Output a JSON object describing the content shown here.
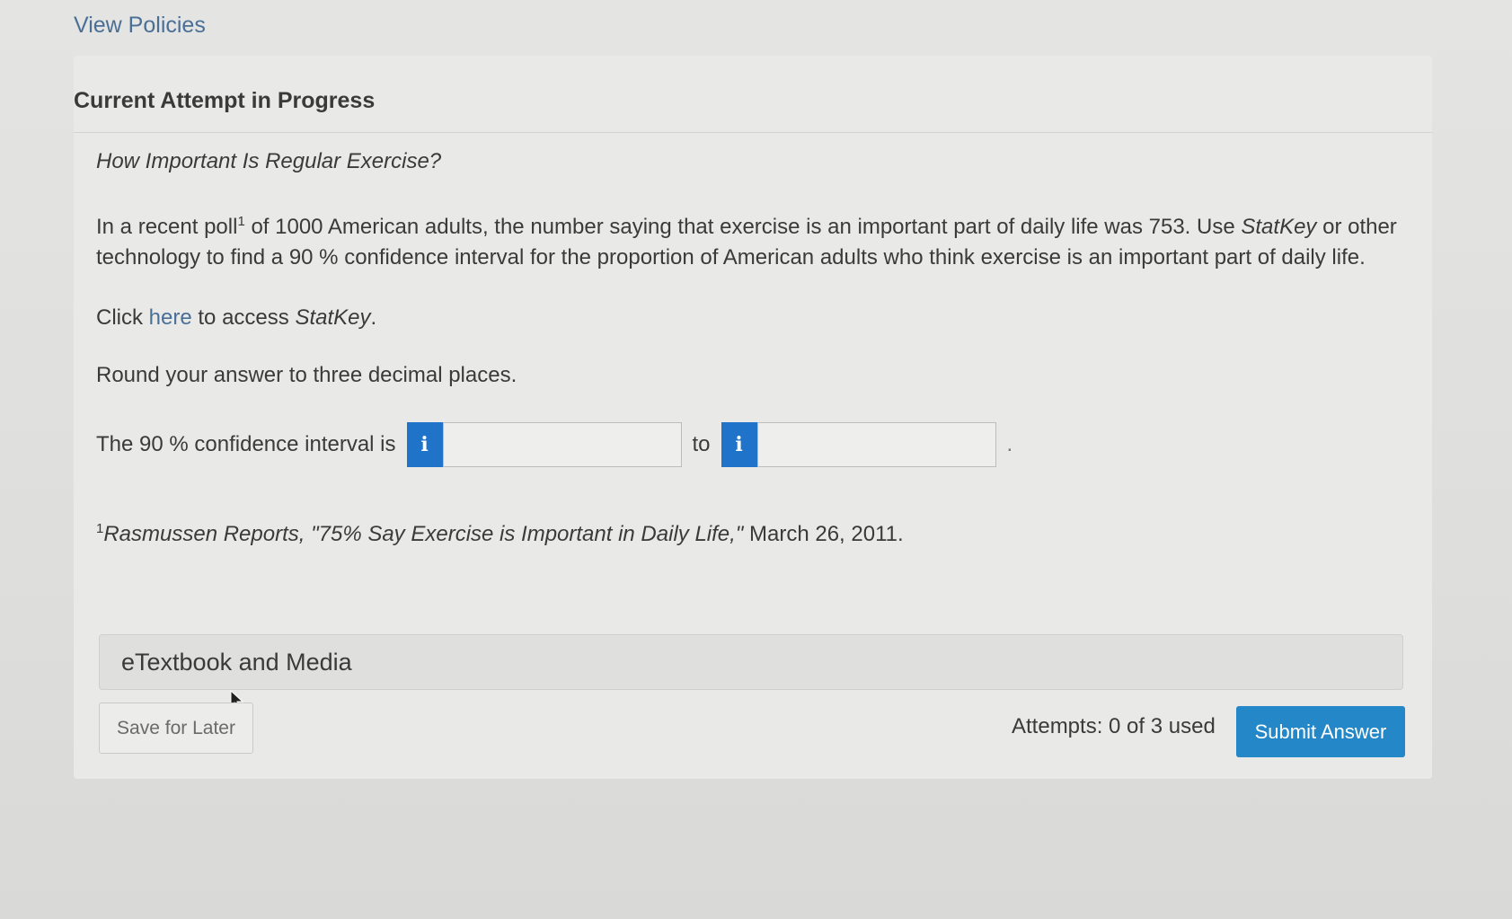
{
  "header": {
    "view_policies": "View Policies"
  },
  "attempt": {
    "title": "Current Attempt in Progress"
  },
  "question": {
    "title": "How Important Is Regular Exercise?",
    "body_part1": "In a recent poll",
    "body_sup": "1",
    "body_part2": " of 1000 American adults, the number saying that exercise is an important part of daily life was 753. Use ",
    "body_statkey": "StatKey",
    "body_part3": " or other technology to find a 90 % confidence interval for the proportion of American adults who think exercise is an important part of daily life.",
    "statkey_prefix": "Click ",
    "statkey_link": "here",
    "statkey_mid": " to access ",
    "statkey_name": "StatKey",
    "statkey_suffix": ".",
    "round_instruction": "Round your answer to three decimal places.",
    "interval_label": "The 90 % confidence interval is",
    "to_label": "to",
    "period": ".",
    "info_glyph": "i",
    "lower_value": "",
    "upper_value": ""
  },
  "footnote": {
    "sup": "1",
    "source": "Rasmussen Reports, \"75% Say Exercise is Important in Daily Life,\"",
    "date": " March 26, 2011."
  },
  "etextbook": {
    "label": "eTextbook and Media"
  },
  "footer": {
    "save_label": "Save for Later",
    "attempts_text": "Attempts: 0 of 3 used",
    "submit_label": "Submit Answer"
  },
  "colors": {
    "link": "#4a6f97",
    "info_button": "#1f73c8",
    "submit_button": "#2487c8"
  },
  "icons": {
    "info": "info-icon",
    "cursor": "mouse-pointer-icon"
  }
}
